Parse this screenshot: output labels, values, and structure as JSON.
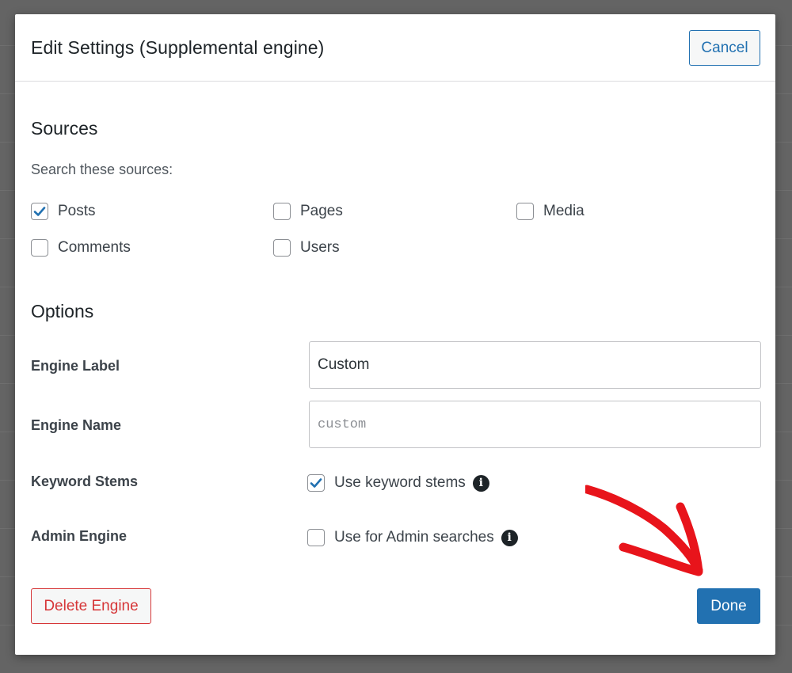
{
  "modal": {
    "title": "Edit Settings (Supplemental engine)",
    "cancel_label": "Cancel"
  },
  "sources": {
    "title": "Sources",
    "hint": "Search these sources:",
    "items": [
      {
        "label": "Posts",
        "checked": true
      },
      {
        "label": "Pages",
        "checked": false
      },
      {
        "label": "Media",
        "checked": false
      },
      {
        "label": "Comments",
        "checked": false
      },
      {
        "label": "Users",
        "checked": false
      }
    ]
  },
  "options": {
    "title": "Options",
    "engine_label": {
      "label": "Engine Label",
      "value": "Custom"
    },
    "engine_name": {
      "label": "Engine Name",
      "value": "custom"
    },
    "keyword_stems": {
      "label": "Keyword Stems",
      "checkbox_label": "Use keyword stems",
      "checked": true,
      "info_icon": "info-icon"
    },
    "admin_engine": {
      "label": "Admin Engine",
      "checkbox_label": "Use for Admin searches",
      "checked": false,
      "info_icon": "info-icon"
    }
  },
  "footer": {
    "delete_label": "Delete Engine",
    "done_label": "Done"
  },
  "colors": {
    "accent": "#2271b1",
    "danger": "#d63638",
    "annotation_arrow": "#e8141b",
    "overlay": "#646464"
  }
}
